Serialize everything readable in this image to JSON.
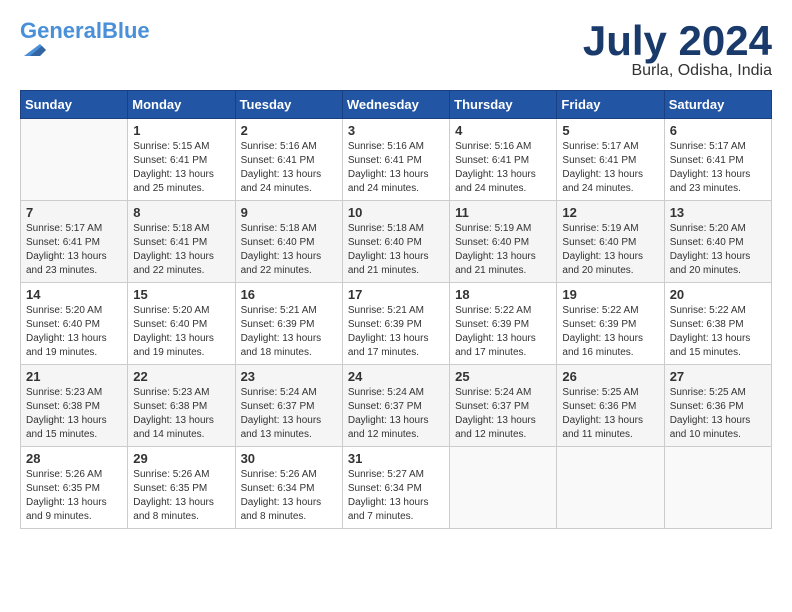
{
  "header": {
    "logo_line1": "General",
    "logo_line1_colored": "Blue",
    "month_title": "July 2024",
    "location": "Burla, Odisha, India"
  },
  "days_of_week": [
    "Sunday",
    "Monday",
    "Tuesday",
    "Wednesday",
    "Thursday",
    "Friday",
    "Saturday"
  ],
  "weeks": [
    [
      {
        "day": "",
        "sunrise": "",
        "sunset": "",
        "daylight": ""
      },
      {
        "day": "1",
        "sunrise": "Sunrise: 5:15 AM",
        "sunset": "Sunset: 6:41 PM",
        "daylight": "Daylight: 13 hours and 25 minutes."
      },
      {
        "day": "2",
        "sunrise": "Sunrise: 5:16 AM",
        "sunset": "Sunset: 6:41 PM",
        "daylight": "Daylight: 13 hours and 24 minutes."
      },
      {
        "day": "3",
        "sunrise": "Sunrise: 5:16 AM",
        "sunset": "Sunset: 6:41 PM",
        "daylight": "Daylight: 13 hours and 24 minutes."
      },
      {
        "day": "4",
        "sunrise": "Sunrise: 5:16 AM",
        "sunset": "Sunset: 6:41 PM",
        "daylight": "Daylight: 13 hours and 24 minutes."
      },
      {
        "day": "5",
        "sunrise": "Sunrise: 5:17 AM",
        "sunset": "Sunset: 6:41 PM",
        "daylight": "Daylight: 13 hours and 24 minutes."
      },
      {
        "day": "6",
        "sunrise": "Sunrise: 5:17 AM",
        "sunset": "Sunset: 6:41 PM",
        "daylight": "Daylight: 13 hours and 23 minutes."
      }
    ],
    [
      {
        "day": "7",
        "sunrise": "Sunrise: 5:17 AM",
        "sunset": "Sunset: 6:41 PM",
        "daylight": "Daylight: 13 hours and 23 minutes."
      },
      {
        "day": "8",
        "sunrise": "Sunrise: 5:18 AM",
        "sunset": "Sunset: 6:41 PM",
        "daylight": "Daylight: 13 hours and 22 minutes."
      },
      {
        "day": "9",
        "sunrise": "Sunrise: 5:18 AM",
        "sunset": "Sunset: 6:40 PM",
        "daylight": "Daylight: 13 hours and 22 minutes."
      },
      {
        "day": "10",
        "sunrise": "Sunrise: 5:18 AM",
        "sunset": "Sunset: 6:40 PM",
        "daylight": "Daylight: 13 hours and 21 minutes."
      },
      {
        "day": "11",
        "sunrise": "Sunrise: 5:19 AM",
        "sunset": "Sunset: 6:40 PM",
        "daylight": "Daylight: 13 hours and 21 minutes."
      },
      {
        "day": "12",
        "sunrise": "Sunrise: 5:19 AM",
        "sunset": "Sunset: 6:40 PM",
        "daylight": "Daylight: 13 hours and 20 minutes."
      },
      {
        "day": "13",
        "sunrise": "Sunrise: 5:20 AM",
        "sunset": "Sunset: 6:40 PM",
        "daylight": "Daylight: 13 hours and 20 minutes."
      }
    ],
    [
      {
        "day": "14",
        "sunrise": "Sunrise: 5:20 AM",
        "sunset": "Sunset: 6:40 PM",
        "daylight": "Daylight: 13 hours and 19 minutes."
      },
      {
        "day": "15",
        "sunrise": "Sunrise: 5:20 AM",
        "sunset": "Sunset: 6:40 PM",
        "daylight": "Daylight: 13 hours and 19 minutes."
      },
      {
        "day": "16",
        "sunrise": "Sunrise: 5:21 AM",
        "sunset": "Sunset: 6:39 PM",
        "daylight": "Daylight: 13 hours and 18 minutes."
      },
      {
        "day": "17",
        "sunrise": "Sunrise: 5:21 AM",
        "sunset": "Sunset: 6:39 PM",
        "daylight": "Daylight: 13 hours and 17 minutes."
      },
      {
        "day": "18",
        "sunrise": "Sunrise: 5:22 AM",
        "sunset": "Sunset: 6:39 PM",
        "daylight": "Daylight: 13 hours and 17 minutes."
      },
      {
        "day": "19",
        "sunrise": "Sunrise: 5:22 AM",
        "sunset": "Sunset: 6:39 PM",
        "daylight": "Daylight: 13 hours and 16 minutes."
      },
      {
        "day": "20",
        "sunrise": "Sunrise: 5:22 AM",
        "sunset": "Sunset: 6:38 PM",
        "daylight": "Daylight: 13 hours and 15 minutes."
      }
    ],
    [
      {
        "day": "21",
        "sunrise": "Sunrise: 5:23 AM",
        "sunset": "Sunset: 6:38 PM",
        "daylight": "Daylight: 13 hours and 15 minutes."
      },
      {
        "day": "22",
        "sunrise": "Sunrise: 5:23 AM",
        "sunset": "Sunset: 6:38 PM",
        "daylight": "Daylight: 13 hours and 14 minutes."
      },
      {
        "day": "23",
        "sunrise": "Sunrise: 5:24 AM",
        "sunset": "Sunset: 6:37 PM",
        "daylight": "Daylight: 13 hours and 13 minutes."
      },
      {
        "day": "24",
        "sunrise": "Sunrise: 5:24 AM",
        "sunset": "Sunset: 6:37 PM",
        "daylight": "Daylight: 13 hours and 12 minutes."
      },
      {
        "day": "25",
        "sunrise": "Sunrise: 5:24 AM",
        "sunset": "Sunset: 6:37 PM",
        "daylight": "Daylight: 13 hours and 12 minutes."
      },
      {
        "day": "26",
        "sunrise": "Sunrise: 5:25 AM",
        "sunset": "Sunset: 6:36 PM",
        "daylight": "Daylight: 13 hours and 11 minutes."
      },
      {
        "day": "27",
        "sunrise": "Sunrise: 5:25 AM",
        "sunset": "Sunset: 6:36 PM",
        "daylight": "Daylight: 13 hours and 10 minutes."
      }
    ],
    [
      {
        "day": "28",
        "sunrise": "Sunrise: 5:26 AM",
        "sunset": "Sunset: 6:35 PM",
        "daylight": "Daylight: 13 hours and 9 minutes."
      },
      {
        "day": "29",
        "sunrise": "Sunrise: 5:26 AM",
        "sunset": "Sunset: 6:35 PM",
        "daylight": "Daylight: 13 hours and 8 minutes."
      },
      {
        "day": "30",
        "sunrise": "Sunrise: 5:26 AM",
        "sunset": "Sunset: 6:34 PM",
        "daylight": "Daylight: 13 hours and 8 minutes."
      },
      {
        "day": "31",
        "sunrise": "Sunrise: 5:27 AM",
        "sunset": "Sunset: 6:34 PM",
        "daylight": "Daylight: 13 hours and 7 minutes."
      },
      {
        "day": "",
        "sunrise": "",
        "sunset": "",
        "daylight": ""
      },
      {
        "day": "",
        "sunrise": "",
        "sunset": "",
        "daylight": ""
      },
      {
        "day": "",
        "sunrise": "",
        "sunset": "",
        "daylight": ""
      }
    ]
  ]
}
